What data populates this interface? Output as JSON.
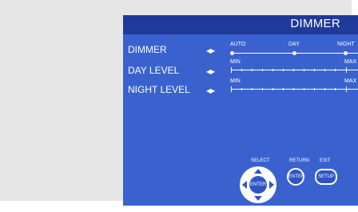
{
  "menu": {
    "title": "DIMMER",
    "rows": [
      {
        "label": "DIMMER",
        "options": [
          "AUTO",
          "DAY",
          "NIGHT"
        ]
      },
      {
        "label": "DAY LEVEL",
        "min": "MIN",
        "max": "MAX"
      },
      {
        "label": "NIGHT LEVEL",
        "min": "MIN",
        "max": "MAX"
      }
    ]
  },
  "controls": {
    "select_label": "SELECT",
    "return_label": "RETURN",
    "exit_label": "EXIT",
    "enter_label": "ENTER",
    "setup_label": "SETUP"
  },
  "colors": {
    "header": "#1f3a99",
    "panel": "#3a62cf",
    "text": "#ffffff"
  }
}
